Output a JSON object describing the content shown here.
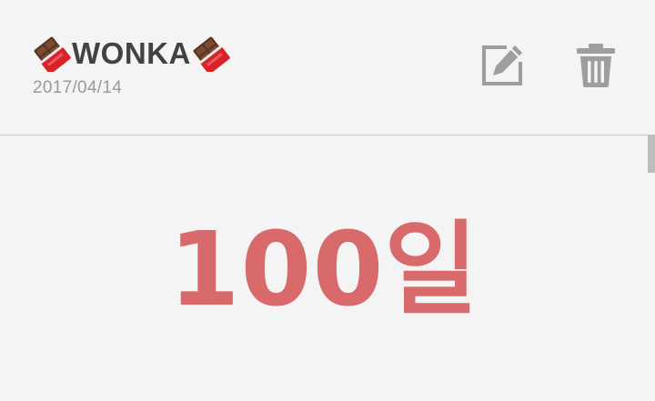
{
  "note": {
    "title": "WONKA",
    "date": "2017/04/14",
    "body": "100일"
  },
  "toolbar": {
    "edit_icon": "edit-icon",
    "delete_icon": "trash-icon"
  },
  "colors": {
    "background": "#f4f4f4",
    "title": "#424242",
    "date": "#9a9a9a",
    "icon": "#9e9e9e",
    "body_text": "#d96a6c",
    "divider": "#c8c8c8"
  }
}
